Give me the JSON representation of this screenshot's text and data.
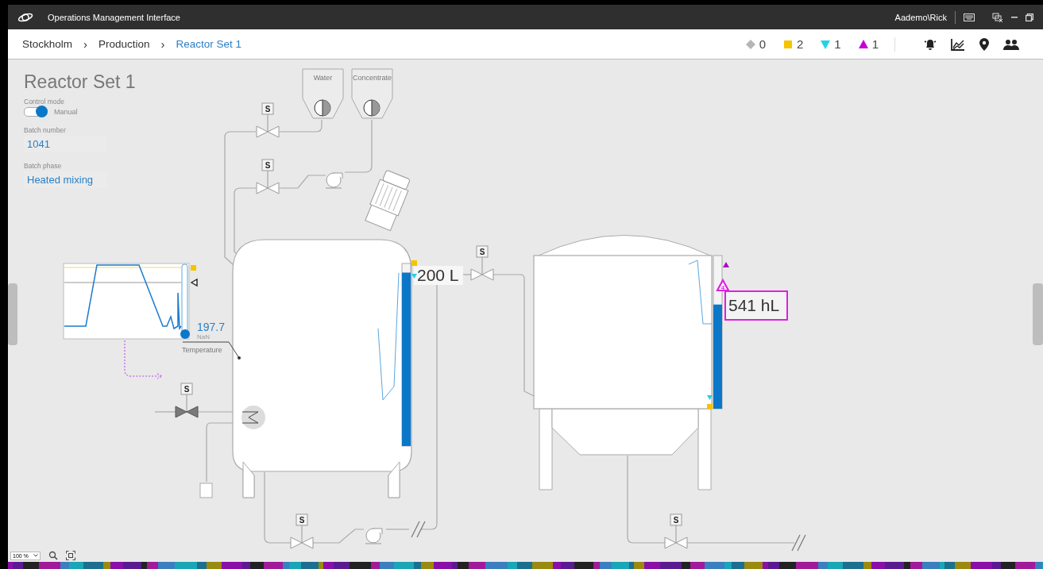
{
  "app": {
    "title": "Operations Management Interface",
    "user": "Aademo\\Rick"
  },
  "breadcrumb": {
    "separator": "›",
    "items": [
      {
        "label": "Stockholm",
        "selected": false
      },
      {
        "label": "Production",
        "selected": false
      },
      {
        "label": "Reactor Set 1",
        "selected": true
      }
    ]
  },
  "alarm_counts": [
    {
      "kind": "diamond",
      "color": "#b5b5b5",
      "count": "0"
    },
    {
      "kind": "square",
      "color": "#f5c400",
      "count": "2"
    },
    {
      "kind": "triangle_down",
      "color": "#22d3e6",
      "count": "1"
    },
    {
      "kind": "triangle_up",
      "color": "#c400d6",
      "count": "1"
    }
  ],
  "panel": {
    "title": "Reactor Set 1",
    "control_mode": {
      "label": "Control mode",
      "value": "Manual",
      "on": true
    },
    "fields": [
      {
        "label": "Batch number",
        "value": "1041"
      },
      {
        "label": "Batch phase",
        "value": "Heated mixing"
      }
    ]
  },
  "diagram": {
    "hoppers": [
      {
        "label": "Water"
      },
      {
        "label": "Concentrate"
      }
    ],
    "valves": [
      {
        "label": "S",
        "closed": false
      },
      {
        "label": "S",
        "closed": false
      },
      {
        "label": "S",
        "closed": true
      },
      {
        "label": "S",
        "closed": false
      },
      {
        "label": "S",
        "closed": false
      },
      {
        "label": "S",
        "closed": false
      }
    ],
    "temperature": {
      "value": "197.7",
      "sub": "NaN",
      "label": "Temperature"
    },
    "tanks": [
      {
        "reading": "200 L",
        "level": 0.95,
        "alarm": false
      },
      {
        "reading": "541 hL",
        "level": 0.68,
        "alarm": true,
        "alarm_badge": "4"
      }
    ]
  },
  "zoom": {
    "value": "100 %"
  }
}
